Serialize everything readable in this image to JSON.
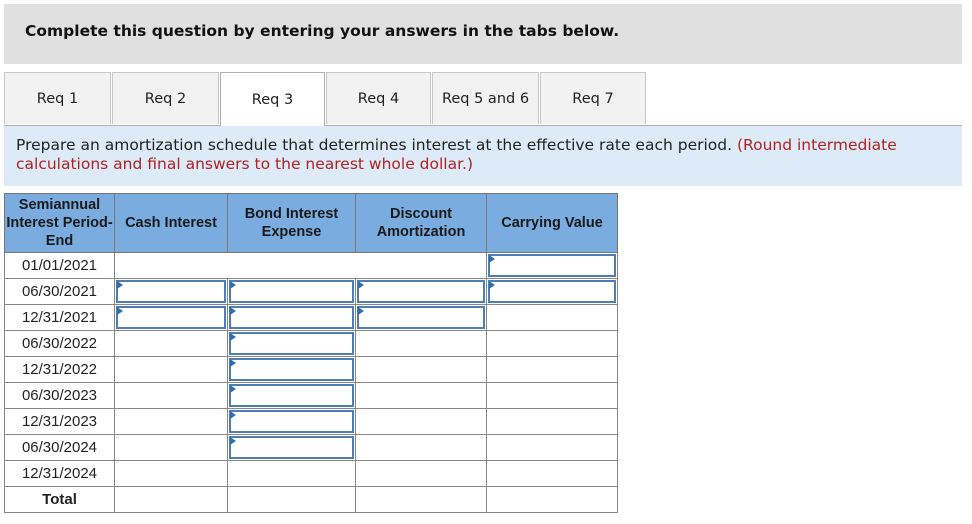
{
  "banner": {
    "text": "Complete this question by entering your answers in the tabs below."
  },
  "tabs": [
    {
      "label": "Req 1",
      "active": false
    },
    {
      "label": "Req 2",
      "active": false
    },
    {
      "label": "Req 3",
      "active": true
    },
    {
      "label": "Req 4",
      "active": false
    },
    {
      "label": "Req 5 and 6",
      "active": false
    },
    {
      "label": "Req 7",
      "active": false
    }
  ],
  "instructions": {
    "text": "Prepare an amortization schedule that determines interest at the effective rate each period.",
    "note": "(Round intermediate calculations and final answers to the nearest whole dollar.)"
  },
  "table": {
    "headers": {
      "period": "Semiannual Interest Period-End",
      "cash_interest": "Cash Interest",
      "bond_interest_expense": "Bond Interest Expense",
      "discount_amortization": "Discount Amortization",
      "carrying_value": "Carrying Value"
    },
    "rows": [
      {
        "date": "01/01/2021",
        "cash_interest": "",
        "bond_interest_expense": "",
        "discount_amortization": "",
        "carrying_value": ""
      },
      {
        "date": "06/30/2021",
        "cash_interest": "",
        "bond_interest_expense": "",
        "discount_amortization": "",
        "carrying_value": ""
      },
      {
        "date": "12/31/2021",
        "cash_interest": "",
        "bond_interest_expense": "",
        "discount_amortization": "",
        "carrying_value": ""
      },
      {
        "date": "06/30/2022",
        "cash_interest": "",
        "bond_interest_expense": "",
        "discount_amortization": "",
        "carrying_value": ""
      },
      {
        "date": "12/31/2022",
        "cash_interest": "",
        "bond_interest_expense": "",
        "discount_amortization": "",
        "carrying_value": ""
      },
      {
        "date": "06/30/2023",
        "cash_interest": "",
        "bond_interest_expense": "",
        "discount_amortization": "",
        "carrying_value": ""
      },
      {
        "date": "12/31/2023",
        "cash_interest": "",
        "bond_interest_expense": "",
        "discount_amortization": "",
        "carrying_value": ""
      },
      {
        "date": "06/30/2024",
        "cash_interest": "",
        "bond_interest_expense": "",
        "discount_amortization": "",
        "carrying_value": ""
      },
      {
        "date": "12/31/2024",
        "cash_interest": "",
        "bond_interest_expense": "",
        "discount_amortization": "",
        "carrying_value": ""
      }
    ],
    "total_label": "Total"
  }
}
